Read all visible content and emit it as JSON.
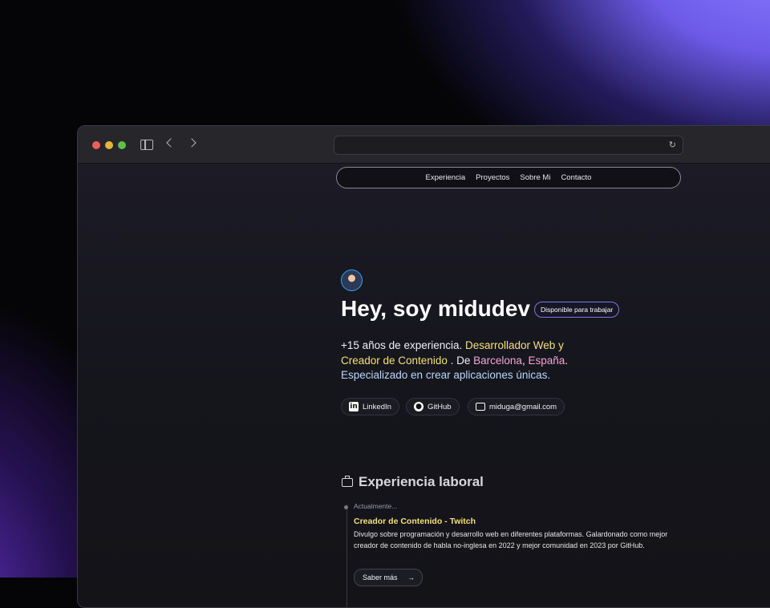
{
  "browser": {
    "url": ""
  },
  "nav": {
    "items": [
      {
        "label": "Experiencia"
      },
      {
        "label": "Proyectos"
      },
      {
        "label": "Sobre Mi"
      },
      {
        "label": "Contacto"
      }
    ]
  },
  "hero": {
    "title": "Hey, soy midudev",
    "badge": "Disponible para trabajar",
    "intro": {
      "p1": "+15 años de experiencia.",
      "role": "Desarrollador Web y Creador de Contenido",
      "p2": ". De",
      "city": "Barcelona",
      "comma": ",",
      "country": "España",
      "dot": ".",
      "specialty": "Especializado en crear aplicaciones únicas."
    },
    "social": {
      "linkedin": "LinkedIn",
      "github": "GitHub",
      "email": "miduga@gmail.com"
    }
  },
  "experience": {
    "title": "Experiencia laboral",
    "items": [
      {
        "date": "Actualmente...",
        "title": "Creador de Contenido - Twitch",
        "description": "Divulgo sobre programación y desarrollo web en diferentes plataformas. Galardonado como mejor creador de contenido de habla no-inglesa en 2022 y mejor comunidad en 2023 por GitHub.",
        "more_label": "Saber más"
      }
    ]
  },
  "icons": {
    "sidebar": "sidebar-icon",
    "back": "chevron-left-icon",
    "forward": "chevron-right-icon",
    "reload": "reload-icon",
    "briefcase": "briefcase-icon",
    "linkedin": "linkedin-icon",
    "github": "github-icon",
    "email": "mail-icon",
    "arrow": "arrow-right-icon"
  },
  "colors": {
    "accent_yellow": "#f4e07a",
    "accent_pink": "#f3a6d6",
    "accent_blue": "#b7d8ff"
  }
}
